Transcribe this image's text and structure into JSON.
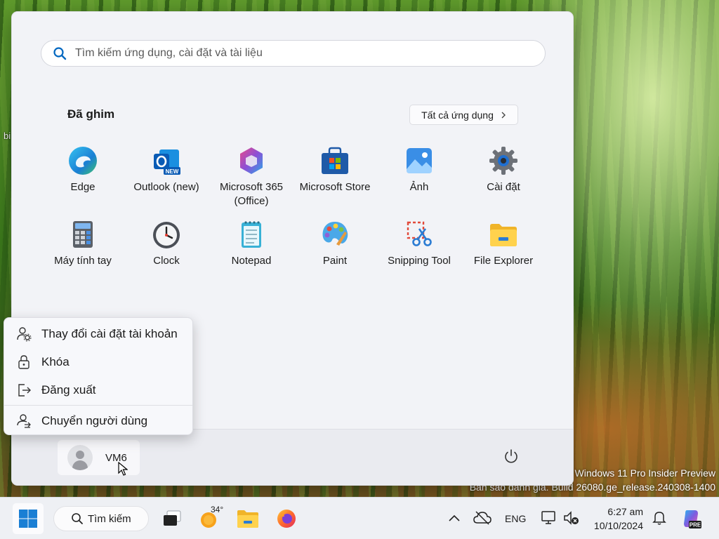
{
  "desktop": {
    "fragment_1": "bi",
    "watermark_line1": "Windows 11 Pro Insider Preview",
    "watermark_line2": "Bản sao đánh giá. Build 26080.ge_release.240308-1400"
  },
  "start_menu": {
    "search_placeholder": "Tìm kiếm ứng dụng, cài đặt và tài liệu",
    "pinned_title": "Đã ghim",
    "all_apps_label": "Tất cả ứng dụng",
    "apps": [
      {
        "label": "Edge",
        "icon": "edge-icon"
      },
      {
        "label": "Outlook (new)",
        "icon": "outlook-icon"
      },
      {
        "label": "Microsoft 365 (Office)",
        "icon": "m365-icon"
      },
      {
        "label": "Microsoft Store",
        "icon": "store-icon"
      },
      {
        "label": "Ảnh",
        "icon": "photos-icon"
      },
      {
        "label": "Cài đặt",
        "icon": "settings-gear-icon"
      },
      {
        "label": "Máy tính tay",
        "icon": "calculator-icon"
      },
      {
        "label": "Clock",
        "icon": "clock-icon"
      },
      {
        "label": "Notepad",
        "icon": "notepad-icon"
      },
      {
        "label": "Paint",
        "icon": "paint-palette-icon"
      },
      {
        "label": "Snipping Tool",
        "icon": "snipping-tool-icon"
      },
      {
        "label": "File Explorer",
        "icon": "folder-icon"
      }
    ],
    "user_name": "VM6",
    "outlook_badge": "NEW"
  },
  "account_menu": {
    "items": [
      {
        "label": "Thay đổi cài đặt tài khoản",
        "icon": "account-settings-icon"
      },
      {
        "label": "Khóa",
        "icon": "lock-icon"
      },
      {
        "label": "Đăng xuất",
        "icon": "sign-out-icon"
      },
      {
        "label": "Chuyển người dùng",
        "icon": "switch-user-icon"
      }
    ]
  },
  "taskbar": {
    "search_label": "Tìm kiếm",
    "weather_temp": "34°",
    "language": "ENG",
    "time": "6:27 am",
    "date": "10/10/2024",
    "copilot_badge": "PRE"
  }
}
